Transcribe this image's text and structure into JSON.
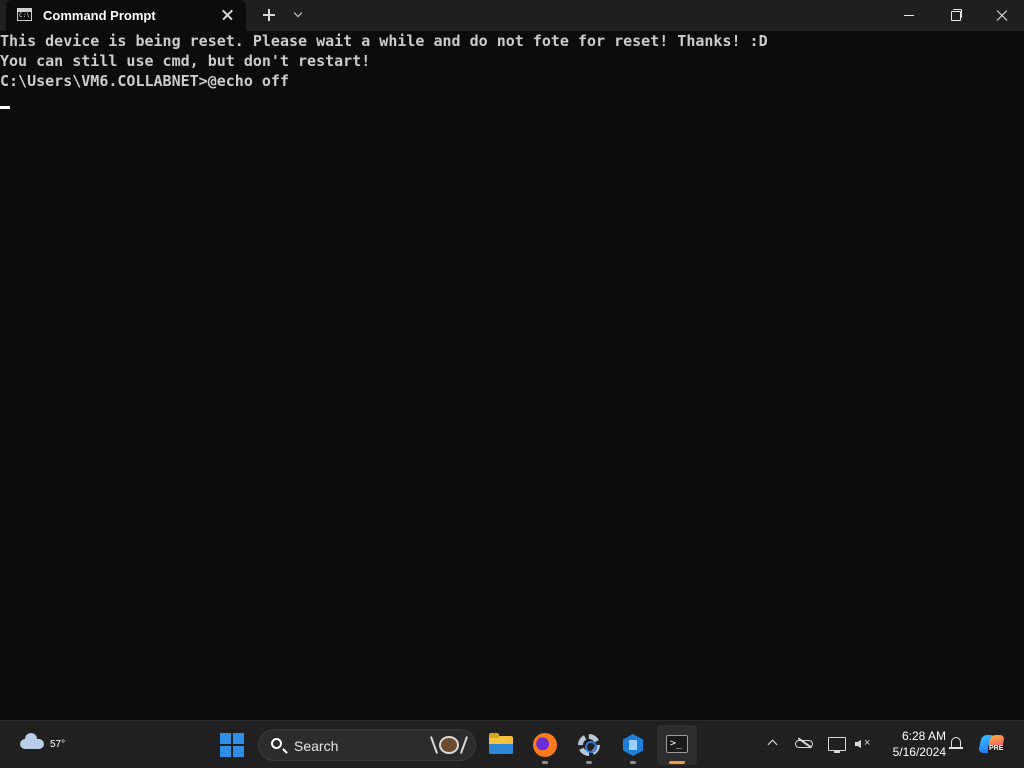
{
  "window": {
    "tab_title": "Command Prompt",
    "tab_icon_glyph": "C:\\.",
    "controls": [
      "minimize-icon",
      "restore-icon",
      "close-icon"
    ]
  },
  "console": {
    "lines": [
      "This device is being reset. Please wait a while and do not fote for reset! Thanks! :D",
      "You can still use cmd, but don't restart!",
      "C:\\Users\\VM6.COLLABNET>@echo off"
    ],
    "text_color": "#cccccc",
    "background": "#0c0c0c"
  },
  "taskbar": {
    "weather": {
      "temperature": "57°",
      "icon": "cloud-icon"
    },
    "search": {
      "label": "Search",
      "highlight_icon": "search-highlight-icon"
    },
    "apps": [
      {
        "name": "File Explorer",
        "icon": "folder-icon"
      },
      {
        "name": "Firefox",
        "icon": "firefox-icon"
      },
      {
        "name": "Settings",
        "icon": "gear-icon"
      },
      {
        "name": "Blue app",
        "icon": "cube-icon"
      },
      {
        "name": "Terminal",
        "icon": "terminal-icon",
        "active": true
      }
    ],
    "tray": {
      "time": "6:28 AM",
      "date": "5/16/2024"
    },
    "copilot_badge": "PRE",
    "terminal_prompt": ">_"
  },
  "colors": {
    "taskbar_bg": "#202020",
    "titlebar_bg": "#1f1f1f",
    "accent": "#2f8fe6",
    "active_indicator": "#f29a3a"
  }
}
